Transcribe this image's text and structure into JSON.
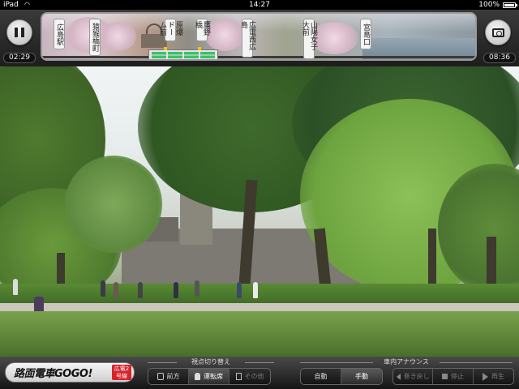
{
  "status_bar": {
    "carrier": "iPad",
    "wifi_icon": "wifi-icon",
    "clock": "14:27",
    "battery": "100%"
  },
  "top_bar": {
    "pause_icon": "pause-icon",
    "camera_icon": "camera-icon",
    "elapsed_time": "02:29",
    "total_time": "08:36",
    "stops": [
      "広島駅",
      "猿猴橋町",
      "原爆ドーム前",
      "鷹野橋",
      "広電西広島",
      "山陽女子大前",
      "宮島口"
    ]
  },
  "bottom_bar": {
    "logo_text": "路面電車GOGO!",
    "logo_badge": "広電2号線",
    "viewpoint": {
      "title": "視点切り替え",
      "options": [
        "前方",
        "運転席",
        "その他"
      ],
      "selected": "運転席"
    },
    "announce": {
      "title": "車内アナウンス",
      "modes": [
        "自動",
        "手動"
      ],
      "selected_mode": "自動",
      "controls": [
        "巻き戻し",
        "停止",
        "再生"
      ]
    }
  },
  "colors": {
    "tram_green": "#3dc06a",
    "badge_red": "#d8222a"
  }
}
